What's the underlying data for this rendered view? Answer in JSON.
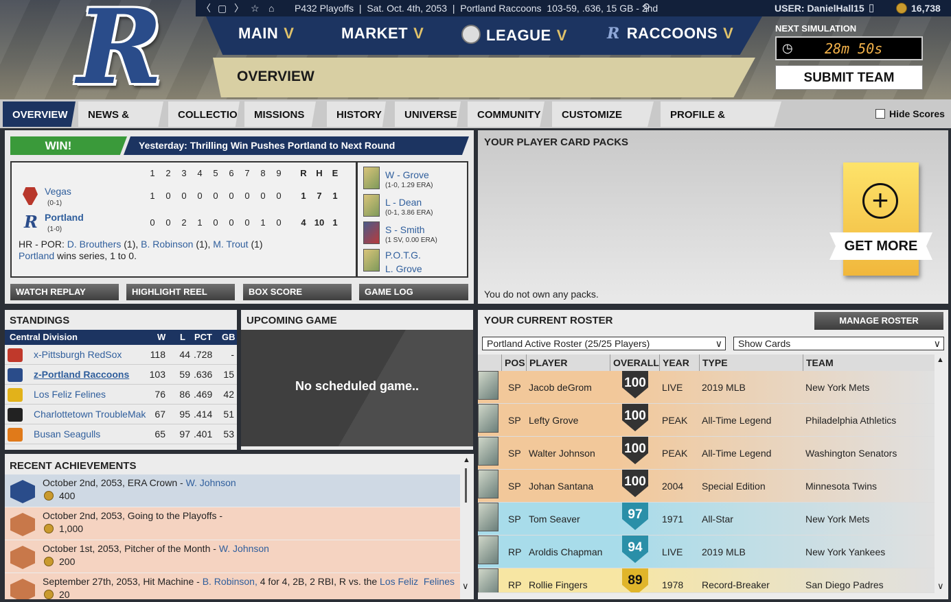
{
  "topbar": {
    "nav_back": "〈",
    "nav_mode": "▢",
    "nav_forward": "〉",
    "star": "☆",
    "home": "⌂",
    "context": "P432 Playoffs  |  Sat. Oct. 4th, 2053  |  Portland Raccoons  103-59, .636, 15 GB - 2nd",
    "user": "USER: DanielHall15",
    "coins": "16,738"
  },
  "logo_letter": "R",
  "nav": {
    "main": "MAIN",
    "market": "MARKET",
    "league": "LEAGUE",
    "raccoons": "RACCOONS",
    "chevron": "V"
  },
  "page_title": "OVERVIEW",
  "next_simulation": {
    "label": "NEXT SIMULATION",
    "time": "28m 50s"
  },
  "submit_label": "SUBMIT TEAM",
  "tabs": [
    "OVERVIEW",
    "NEWS & MAIL",
    "COLLECTION",
    "MISSIONS",
    "HISTORY",
    "UNIVERSE",
    "COMMUNITY",
    "CUSTOMIZE TEAM",
    "PROFILE & SETTINGS"
  ],
  "hide_scores": "Hide Scores",
  "result": {
    "badge": "WIN!",
    "headline": "Yesterday: Thrilling Win Pushes Portland to Next Round",
    "innings": [
      "1",
      "2",
      "3",
      "4",
      "5",
      "6",
      "7",
      "8",
      "9"
    ],
    "rhe": [
      "R",
      "H",
      "E"
    ],
    "teams": [
      {
        "name": "Vegas",
        "record": "(0-1)",
        "line": [
          "1",
          "0",
          "0",
          "0",
          "0",
          "0",
          "0",
          "0",
          "0"
        ],
        "r": "1",
        "h": "7",
        "e": "1"
      },
      {
        "name": "Portland",
        "record": "(1-0)",
        "line": [
          "0",
          "0",
          "2",
          "1",
          "0",
          "0",
          "0",
          "1",
          "0"
        ],
        "r": "4",
        "h": "10",
        "e": "1"
      }
    ],
    "hr_prefix": "HR - POR:",
    "hr_players": [
      "D. Brouthers",
      "B. Robinson",
      "M. Trout"
    ],
    "hr_counts": [
      "(1),",
      "(1),",
      "(1)"
    ],
    "series_team": "Portland",
    "series_text": "wins series, 1 to 0.",
    "pitchers": [
      {
        "label": "W - Grove",
        "stat": "(1-0, 1.29 ERA)"
      },
      {
        "label": "L - Dean",
        "stat": "(0-1, 3.86 ERA)"
      },
      {
        "label": "S - Smith",
        "stat": "(1 SV, 0.00 ERA)"
      },
      {
        "label": "P.O.T.G.",
        "stat": "L. Grove"
      }
    ],
    "buttons": [
      "WATCH REPLAY",
      "HIGHLIGHT REEL",
      "BOX SCORE",
      "GAME LOG"
    ]
  },
  "packs": {
    "title": "YOUR PLAYER CARD PACKS",
    "get_more": "GET MORE",
    "plus": "+",
    "empty": "You do not own any packs."
  },
  "standings": {
    "title": "STANDINGS",
    "headers": [
      "Central Division",
      "W",
      "L",
      "PCT",
      "GB"
    ],
    "rows": [
      {
        "team": "x-Pittsburgh RedSox",
        "w": "118",
        "l": "44",
        "pct": ".728",
        "gb": "-",
        "color": "#c0392b"
      },
      {
        "team": "z-Portland Raccoons",
        "w": "103",
        "l": "59",
        "pct": ".636",
        "gb": "15",
        "color": "#2a4c8a"
      },
      {
        "team": "Los Feliz  Felines",
        "w": "76",
        "l": "86",
        "pct": ".469",
        "gb": "42",
        "color": "#e2b21a"
      },
      {
        "team": "Charlottetown TroubleMak",
        "w": "67",
        "l": "95",
        "pct": ".414",
        "gb": "51",
        "color": "#222222"
      },
      {
        "team": "Busan Seagulls",
        "w": "65",
        "l": "97",
        "pct": ".401",
        "gb": "53",
        "color": "#e07a1a"
      }
    ]
  },
  "upcoming": {
    "title": "UPCOMING GAME",
    "message": "No scheduled game.."
  },
  "achievements": {
    "title": "RECENT ACHIEVEMENTS",
    "items": [
      {
        "text": "October 2nd, 2053, ERA Crown - ",
        "link": "W. Johnson",
        "reward": "400",
        "bg": "#cfd9e4",
        "medal": "#2a4c8a"
      },
      {
        "text": "October 2nd, 2053, Going to the Playoffs -",
        "link": "",
        "reward": "1,000",
        "bg": "#f5d3c1",
        "medal": "#c8784a"
      },
      {
        "text": "October 1st, 2053, Pitcher of the Month - ",
        "link": "W. Johnson",
        "reward": "200",
        "bg": "#f5d3c1",
        "medal": "#c8784a"
      },
      {
        "text": "September 27th, 2053, Hit Machine - ",
        "link": "B. Robinson,",
        "extra": " 4 for 4, 2B, 2 RBI, R vs. the ",
        "link2": "Los Feliz  Felines",
        "reward": "20",
        "bg": "#f5d3c1",
        "medal": "#c8784a"
      }
    ]
  },
  "roster": {
    "title": "YOUR CURRENT ROSTER",
    "manage": "MANAGE ROSTER",
    "select_roster": "Portland Active Roster (25/25 Players)",
    "select_view": "Show Cards",
    "dropdown": "∨",
    "headers": [
      "POS",
      "PLAYER",
      "OVERALL",
      "YEAR",
      "TYPE",
      "TEAM"
    ],
    "rows": [
      {
        "pos": "SP",
        "player": "Jacob deGrom",
        "overall": "100",
        "year": "LIVE",
        "type": "2019 MLB",
        "team": "New York Mets",
        "bg": "#f2c89a",
        "badge": "#333333"
      },
      {
        "pos": "SP",
        "player": "Lefty Grove",
        "overall": "100",
        "year": "PEAK",
        "type": "All-Time Legend",
        "team": "Philadelphia Athletics",
        "bg": "#f2c89a",
        "badge": "#333333"
      },
      {
        "pos": "SP",
        "player": "Walter Johnson",
        "overall": "100",
        "year": "PEAK",
        "type": "All-Time Legend",
        "team": "Washington Senators",
        "bg": "#f2c89a",
        "badge": "#333333"
      },
      {
        "pos": "SP",
        "player": "Johan Santana",
        "overall": "100",
        "year": "2004",
        "type": "Special Edition",
        "team": "Minnesota Twins",
        "bg": "#f2c89a",
        "badge": "#333333"
      },
      {
        "pos": "SP",
        "player": "Tom Seaver",
        "overall": "97",
        "year": "1971",
        "type": "All-Star",
        "team": "New York Mets",
        "bg": "#a8dcea",
        "badge": "#2a8fa8"
      },
      {
        "pos": "RP",
        "player": "Aroldis Chapman",
        "overall": "94",
        "year": "LIVE",
        "type": "2019 MLB",
        "team": "New York Yankees",
        "bg": "#a8dcea",
        "badge": "#2a8fa8"
      },
      {
        "pos": "RP",
        "player": "Rollie Fingers",
        "overall": "89",
        "year": "1978",
        "type": "Record-Breaker",
        "team": "San Diego Padres",
        "bg": "#f7e6a3",
        "badge": "#e0b52a"
      }
    ]
  },
  "scroll": {
    "up": "▲",
    "down": "∨"
  }
}
